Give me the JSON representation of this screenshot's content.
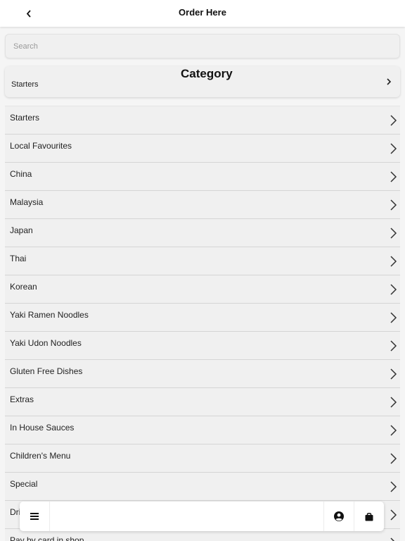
{
  "header": {
    "title": "Order Here",
    "back_icon": "chevron-left-icon"
  },
  "search": {
    "placeholder": "Search",
    "value": ""
  },
  "category": {
    "heading": "Category",
    "selected": "Starters",
    "icon": "chevron-right-icon"
  },
  "categories": [
    "Starters",
    "Local Favourites",
    "China",
    "Malaysia",
    "Japan",
    "Thai",
    "Korean",
    "Yaki Ramen Noodles",
    "Yaki Udon Noodles",
    "Gluten Free Dishes",
    "Extras",
    "In House Sauces",
    "Children's Menu",
    "Special",
    "Drinks",
    "Pay by card in shop"
  ],
  "bottom_bar": {
    "menu_icon": "hamburger-menu-icon",
    "account_icon": "user-circle-icon",
    "cart_icon": "shopping-bag-icon"
  },
  "colors": {
    "background": "#f5f5f5",
    "card": "#f0f0f0",
    "text": "#222222",
    "divider": "#d5d5d5"
  }
}
